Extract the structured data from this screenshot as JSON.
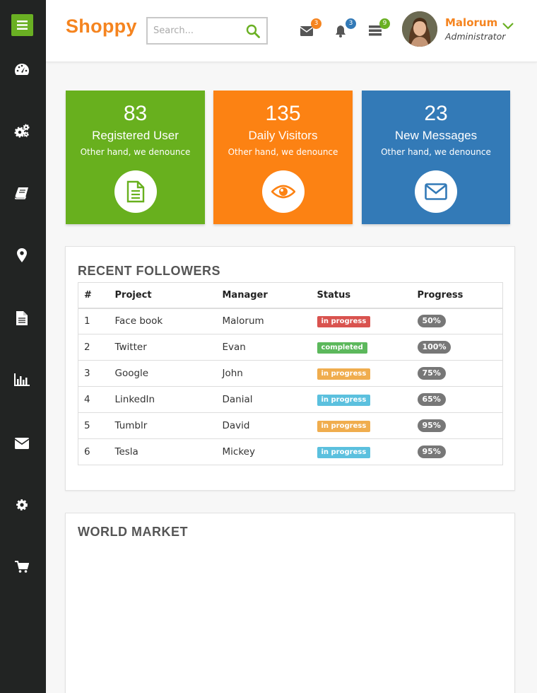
{
  "brand": "Shoppy",
  "search": {
    "placeholder": "Search..."
  },
  "notifications": [
    {
      "icon": "envelope-icon",
      "count": "3",
      "color": "#f5841f"
    },
    {
      "icon": "bell-icon",
      "count": "3",
      "color": "#337ab7"
    },
    {
      "icon": "tasks-icon",
      "count": "9",
      "color": "#6ab023"
    }
  ],
  "user": {
    "name": "Malorum",
    "role": "Administrator"
  },
  "sidebar": {
    "items": [
      {
        "icon": "dashboard-icon"
      },
      {
        "icon": "cogs-icon"
      },
      {
        "icon": "book-icon"
      },
      {
        "icon": "map-marker-icon"
      },
      {
        "icon": "file-icon"
      },
      {
        "icon": "bar-chart-icon"
      },
      {
        "icon": "envelope-icon"
      },
      {
        "icon": "gear-icon"
      },
      {
        "icon": "shopping-cart-icon"
      }
    ]
  },
  "stats": [
    {
      "value": "83",
      "title": "Registered User",
      "subtitle": "Other hand, we denounce",
      "icon": "file-text-icon",
      "color": "#68b01e"
    },
    {
      "value": "135",
      "title": "Daily Visitors",
      "subtitle": "Other hand, we denounce",
      "icon": "eye-icon",
      "color": "#fc8213"
    },
    {
      "value": "23",
      "title": "New Messages",
      "subtitle": "Other hand, we denounce",
      "icon": "envelope-icon",
      "color": "#337ab7"
    }
  ],
  "followers": {
    "title": "RECENT FOLLOWERS",
    "headers": [
      "#",
      "Project",
      "Manager",
      "Status",
      "Progress"
    ],
    "rows": [
      {
        "num": "1",
        "project": "Face book",
        "manager": "Malorum",
        "status": "in progress",
        "status_color": "#d9534f",
        "progress": "50%"
      },
      {
        "num": "2",
        "project": "Twitter",
        "manager": "Evan",
        "status": "completed",
        "status_color": "#5cb85c",
        "progress": "100%"
      },
      {
        "num": "3",
        "project": "Google",
        "manager": "John",
        "status": "in progress",
        "status_color": "#f0ad4e",
        "progress": "75%"
      },
      {
        "num": "4",
        "project": "LinkedIn",
        "manager": "Danial",
        "status": "in progress",
        "status_color": "#5bc0de",
        "progress": "65%"
      },
      {
        "num": "5",
        "project": "Tumblr",
        "manager": "David",
        "status": "in progress",
        "status_color": "#f0ad4e",
        "progress": "95%"
      },
      {
        "num": "6",
        "project": "Tesla",
        "manager": "Mickey",
        "status": "in progress",
        "status_color": "#5bc0de",
        "progress": "95%"
      }
    ]
  },
  "world_market": {
    "title": "WORLD MARKET"
  }
}
